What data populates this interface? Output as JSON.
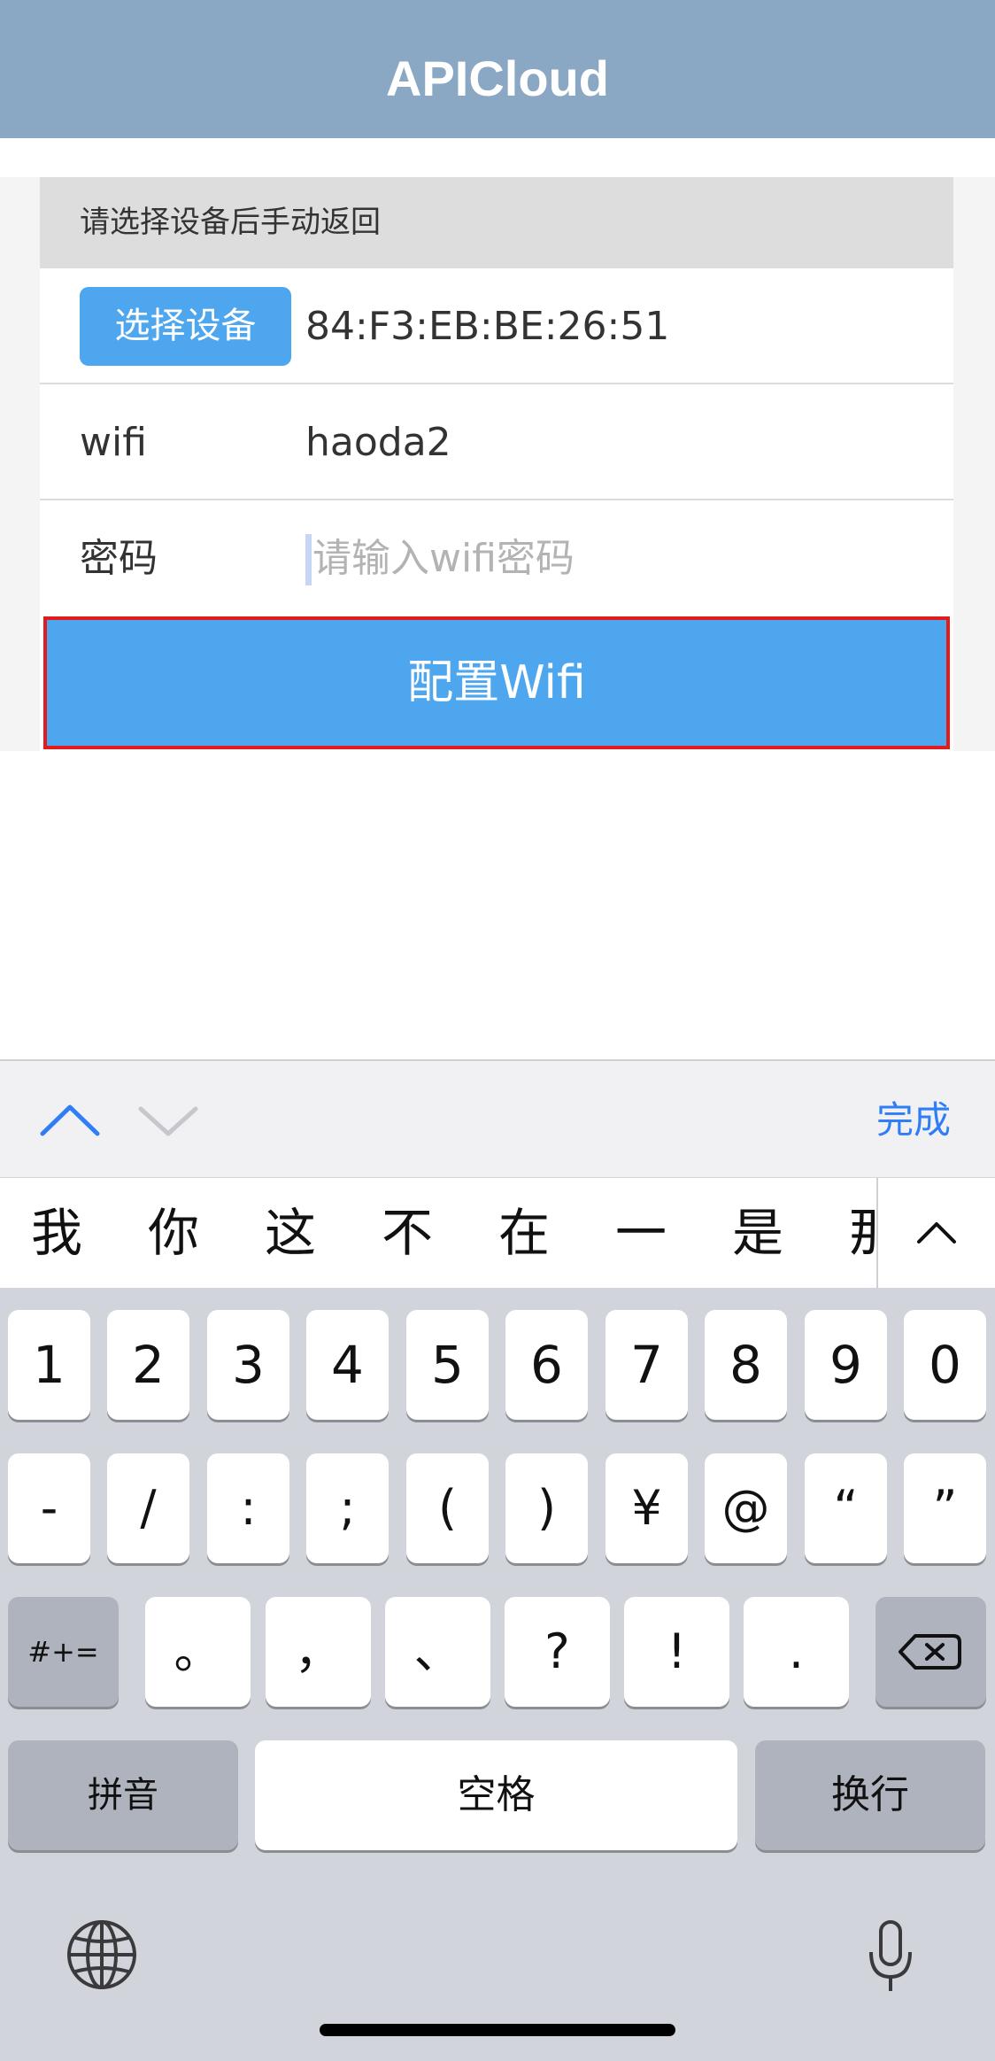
{
  "header": {
    "title": "APICloud"
  },
  "form": {
    "hint": "请选择设备后手动返回",
    "select_device_label": "选择设备",
    "device_mac": "84:F3:EB:BE:26:51",
    "wifi_label": "wifi",
    "wifi_value": "haoda2",
    "password_label": "密码",
    "password_placeholder": "请输入wifi密码",
    "password_value": "",
    "config_button": "配置Wifi"
  },
  "keyboard_toolbar": {
    "done_label": "完成"
  },
  "candidates": [
    "我",
    "你",
    "这",
    "不",
    "在",
    "一",
    "是",
    "那"
  ],
  "keyboard": {
    "row1": [
      "1",
      "2",
      "3",
      "4",
      "5",
      "6",
      "7",
      "8",
      "9",
      "0"
    ],
    "row2": [
      "-",
      "/",
      ":",
      ";",
      "(",
      ")",
      "¥",
      "@",
      "“",
      "”"
    ],
    "row3_mode": "#+=",
    "row3": [
      "。",
      "，",
      "、",
      "?",
      "!",
      "."
    ],
    "pinyin_label": "拼音",
    "space_label": "空格",
    "return_label": "换行"
  },
  "colors": {
    "header_bg": "#8aa8c3",
    "accent_blue": "#4da6ee",
    "highlight_border": "#e21b1b",
    "done_blue": "#2f7ef6"
  }
}
